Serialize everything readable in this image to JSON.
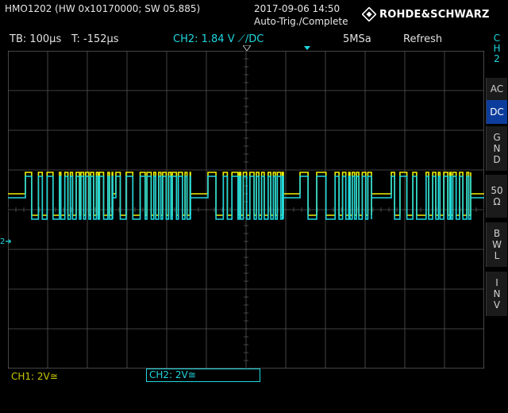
{
  "header": {
    "device": "HMO1202 (HW 0x10170000; SW 05.885)",
    "datetime": "2017-09-06 14:50",
    "acq_status": "Auto-Trig./Complete",
    "brand": "ROHDE&SCHWARZ"
  },
  "statusbar": {
    "timebase": "TB: 100µs",
    "trigger_time": "T: -152µs",
    "ch2_trigger": "CH2: 1.84 V ⟋/DC",
    "sample_rate": "5MSa",
    "mode": "Refresh"
  },
  "side_menu": {
    "channel_tag": [
      "C",
      "H",
      "2"
    ],
    "buttons": [
      {
        "label": [
          "AC"
        ],
        "active": false
      },
      {
        "label": [
          "DC"
        ],
        "active": true
      },
      {
        "label": [
          "G",
          "N",
          "D"
        ],
        "active": false
      },
      {
        "label": [
          "50",
          "Ω"
        ],
        "active": false
      },
      {
        "label": [
          "B",
          "W",
          "L"
        ],
        "active": false
      },
      {
        "label": [
          "I",
          "N",
          "V"
        ],
        "active": false
      }
    ]
  },
  "bottom": {
    "ch1": "CH1: 2V≅",
    "ch2": "CH2: 2V≅"
  },
  "markers": {
    "ch2_ground": "2"
  },
  "colors": {
    "ch1": "#f0f000",
    "ch2": "#1fd7e0",
    "grid": "#555555",
    "menu_active": "#0d3d9c",
    "screen_bg": "#000000"
  },
  "icons": {
    "logo": "rs-diamond-icon",
    "trigger_pos": "trigger-position-marker-icon",
    "trigger_level": "trigger-level-marker-icon",
    "ground": "ch2-ground-marker-icon"
  }
}
